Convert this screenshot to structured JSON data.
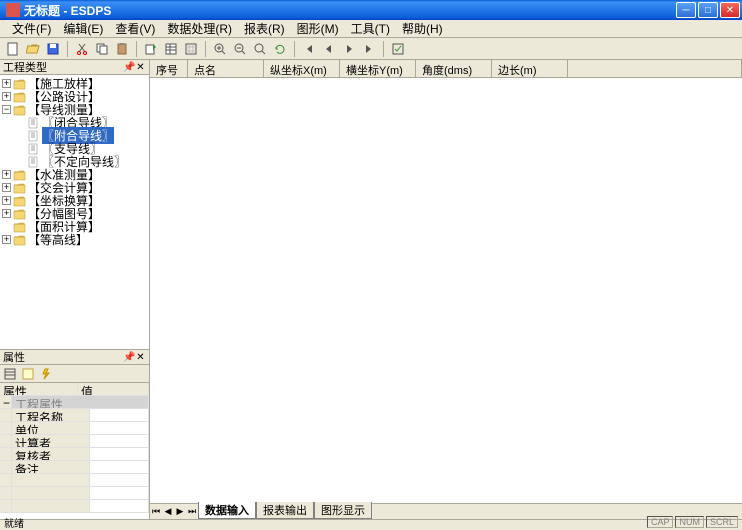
{
  "title": "无标题 - ESDPS",
  "menu": {
    "file": "文件(F)",
    "edit": "编辑(E)",
    "view": "查看(V)",
    "data": "数据处理(R)",
    "report": "报表(R)",
    "graph": "图形(M)",
    "tool": "工具(T)",
    "help": "帮助(H)"
  },
  "leftpane": {
    "title": "工程类型"
  },
  "tree": [
    {
      "label": "【施工放样】",
      "exp": "+",
      "kind": "folder"
    },
    {
      "label": "【公路设计】",
      "exp": "+",
      "kind": "folder"
    },
    {
      "label": "【导线测量】",
      "exp": "-",
      "kind": "folder",
      "children": [
        {
          "label": "〖闭合导线〗",
          "kind": "page"
        },
        {
          "label": "〖附合导线〗",
          "kind": "page",
          "sel": true
        },
        {
          "label": "〖支导线〗",
          "kind": "page"
        },
        {
          "label": "〖不定向导线〗",
          "kind": "page"
        }
      ]
    },
    {
      "label": "【水准测量】",
      "exp": "+",
      "kind": "folder"
    },
    {
      "label": "【交会计算】",
      "exp": "+",
      "kind": "folder"
    },
    {
      "label": "【坐标换算】",
      "exp": "+",
      "kind": "folder"
    },
    {
      "label": "【分幅图号】",
      "exp": "+",
      "kind": "folder"
    },
    {
      "label": "【面积计算】",
      "kind": "folder"
    },
    {
      "label": "【等高线】",
      "exp": "+",
      "kind": "folder"
    }
  ],
  "proppane": {
    "title": "属性",
    "header": {
      "k": "属性",
      "v": "值"
    },
    "category": "工程属性",
    "rows": [
      {
        "k": "工程名称",
        "v": ""
      },
      {
        "k": "单位",
        "v": ""
      },
      {
        "k": "计算者",
        "v": ""
      },
      {
        "k": "复核者",
        "v": ""
      },
      {
        "k": "备注",
        "v": ""
      }
    ]
  },
  "grid": {
    "cols": [
      "序号",
      "点名",
      "纵坐标X(m)",
      "横坐标Y(m)",
      "角度(dms)",
      "边长(m)",
      ""
    ]
  },
  "tabs": {
    "items": [
      "数据输入",
      "报表输出",
      "图形显示"
    ],
    "active": 0
  },
  "status": {
    "ready": "就绪",
    "cap": "CAP",
    "num": "NUM",
    "scrl": "SCRL"
  }
}
